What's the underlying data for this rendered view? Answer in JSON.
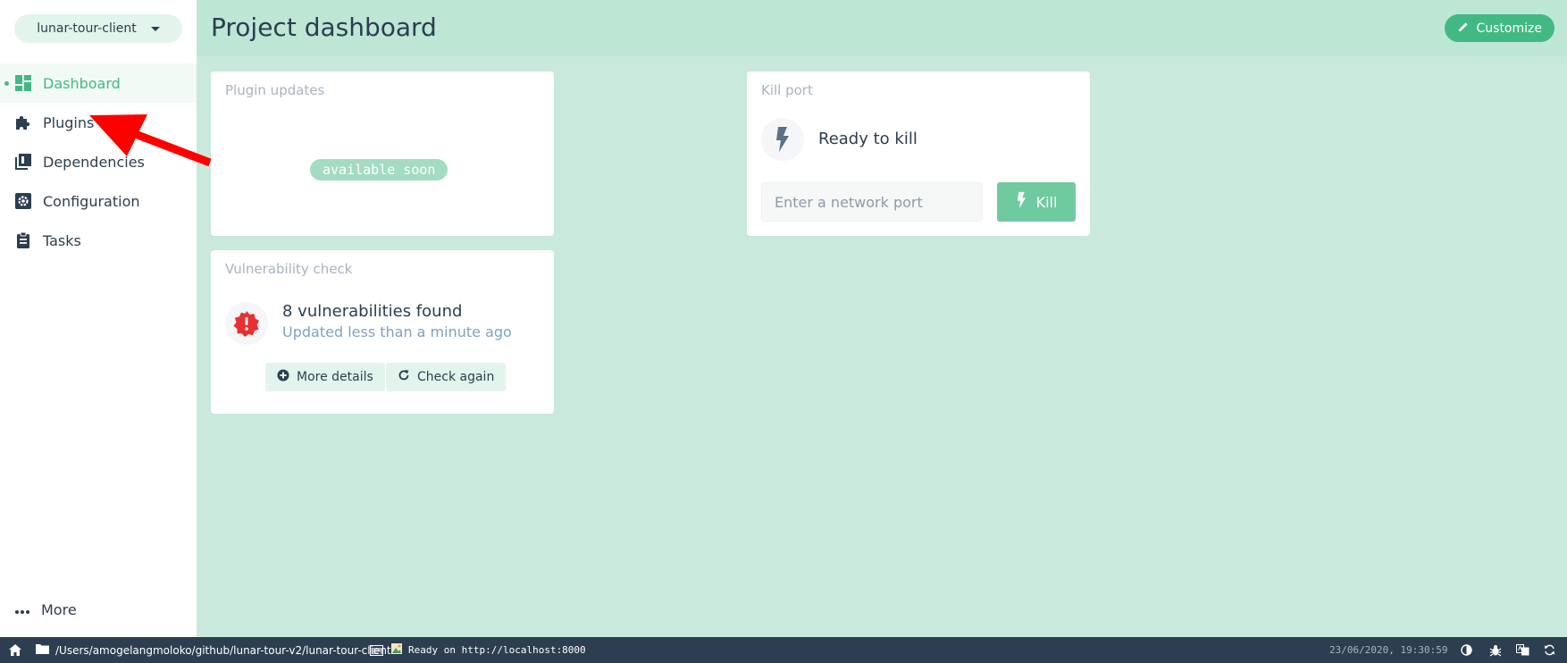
{
  "sidebar": {
    "project_name": "lunar-tour-client",
    "items": [
      {
        "label": "Dashboard",
        "icon": "dashboard-icon"
      },
      {
        "label": "Plugins",
        "icon": "puzzle-icon"
      },
      {
        "label": "Dependencies",
        "icon": "library-icon"
      },
      {
        "label": "Configuration",
        "icon": "settings-icon"
      },
      {
        "label": "Tasks",
        "icon": "clipboard-icon"
      }
    ],
    "more_label": "More"
  },
  "header": {
    "title": "Project dashboard",
    "customize_label": "Customize"
  },
  "plugin_updates": {
    "title": "Plugin updates",
    "badge": "available soon"
  },
  "vulnerability": {
    "title": "Vulnerability check",
    "status": "8 vulnerabilities found",
    "updated": "Updated less than a minute ago",
    "details_label": "More details",
    "check_label": "Check again"
  },
  "kill_port": {
    "title": "Kill port",
    "status": "Ready to kill",
    "placeholder": "Enter a network port",
    "button_label": "Kill"
  },
  "statusbar": {
    "path": "/Users/amogelangmoloko/github/lunar-tour-v2/lunar-tour-client",
    "message": "Ready on http://localhost:8000",
    "datetime": "23/06/2020, 19:30:59"
  },
  "colors": {
    "accent": "#42b983",
    "background": "#c8e9dc",
    "danger": "#e83030",
    "statusbar": "#2c3e50",
    "annotation_arrow": "#ff0000"
  }
}
